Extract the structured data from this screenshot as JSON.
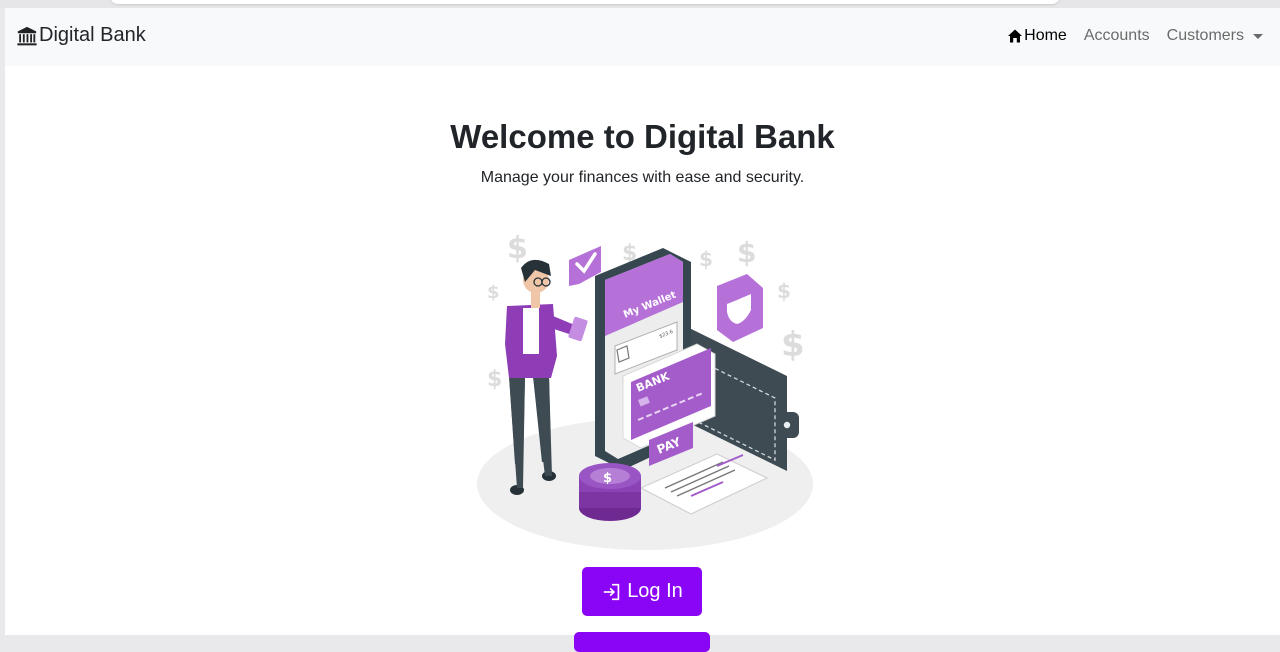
{
  "navbar": {
    "brand": "Digital Bank",
    "brand_icon": "bank-icon",
    "links": [
      {
        "label": "Home",
        "icon": "home-icon",
        "active": true
      },
      {
        "label": "Accounts"
      },
      {
        "label": "Customers",
        "dropdown": true
      }
    ]
  },
  "hero": {
    "title": "Welcome to Digital Bank",
    "subtitle": "Manage your finances with ease and security."
  },
  "illustration": {
    "wallet_label": "My Wallet",
    "card_label": "BANK",
    "pay_label": "PAY",
    "amount_label": "$23.6"
  },
  "actions": {
    "login_label": "Log In",
    "login_icon": "login-icon"
  },
  "colors": {
    "accent": "#8a05f5",
    "illustration_purple": "#a35cc9",
    "navbar_bg": "#f8f9fa"
  }
}
